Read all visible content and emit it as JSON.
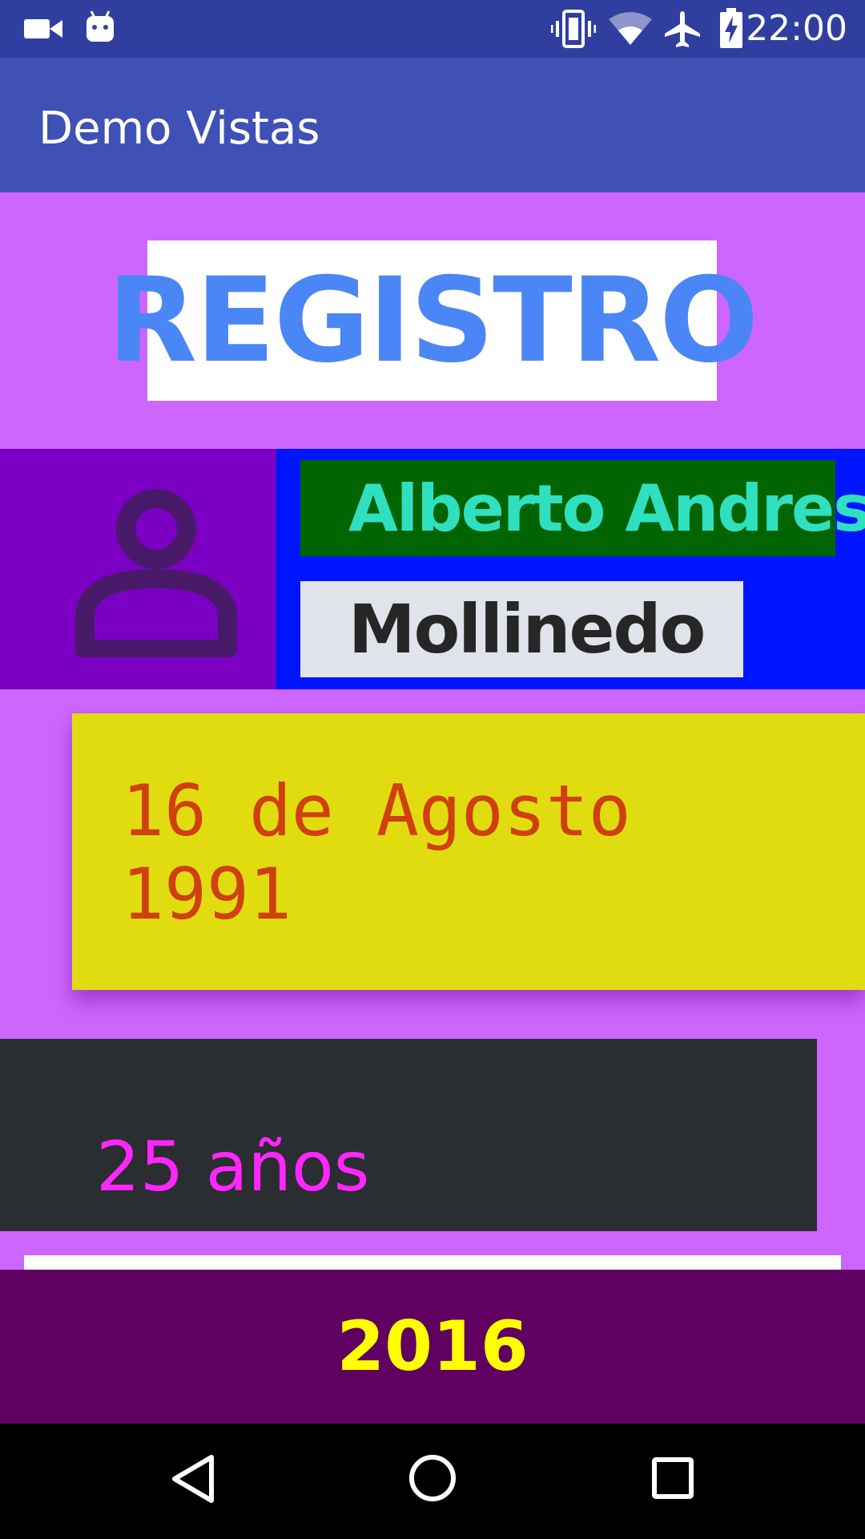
{
  "status_bar": {
    "time": "22:00",
    "icons": [
      "video-camera-icon",
      "android-icon",
      "vibrate-icon",
      "wifi-icon",
      "airplane-icon",
      "battery-charging-icon"
    ]
  },
  "app_bar": {
    "title": "Demo Vistas"
  },
  "registro": {
    "heading": "REGISTRO"
  },
  "profile": {
    "avatar_icon": "person-icon",
    "first_name": "Alberto Andres",
    "last_name": "Mollinedo"
  },
  "birth": {
    "date": "16 de Agosto 1991"
  },
  "age": {
    "text": "25 años"
  },
  "footer": {
    "year": "2016"
  },
  "nav_bar": {
    "icons": [
      "back-icon",
      "home-icon",
      "recents-icon"
    ]
  },
  "colors": {
    "status_bar": "#303f9f",
    "app_bar": "#3f51b5",
    "background": "#cc66ff",
    "registro_text": "#4a86f5",
    "first_name_bg": "#006400",
    "first_name_text": "#2fe0c0",
    "name_panel": "#0015ff",
    "avatar_bg": "#7b00c4",
    "date_bg": "#e0dc10",
    "date_text": "#d0400f",
    "age_bg": "#2a2e31",
    "age_text": "#ff26ff",
    "year_bg": "#600060",
    "year_text": "#ffff00"
  }
}
